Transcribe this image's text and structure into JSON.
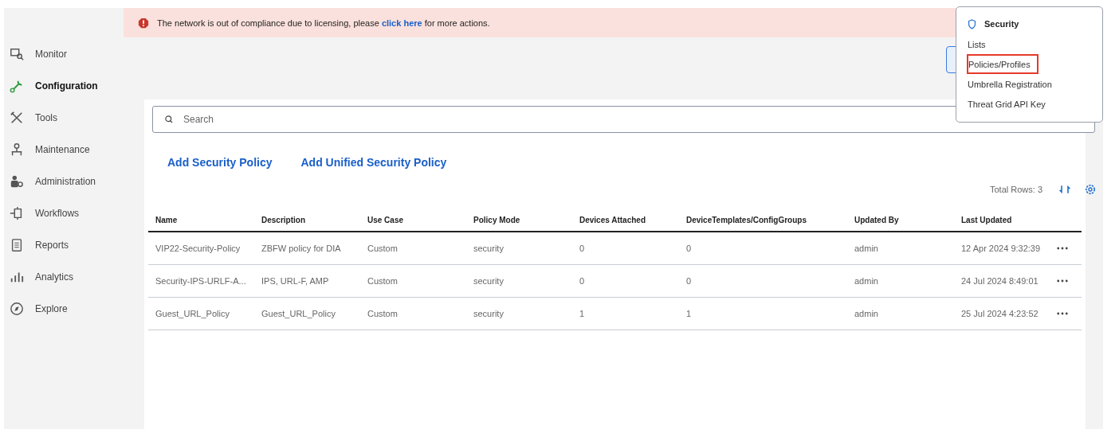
{
  "sidebar": {
    "items": [
      {
        "label": "Monitor",
        "kind": "monitor",
        "selected": false
      },
      {
        "label": "Configuration",
        "kind": "wrench",
        "selected": true
      },
      {
        "label": "Tools",
        "kind": "tools",
        "selected": false
      },
      {
        "label": "Maintenance",
        "kind": "maintenance",
        "selected": false
      },
      {
        "label": "Administration",
        "kind": "admin",
        "selected": false
      },
      {
        "label": "Workflows",
        "kind": "workflow",
        "selected": false
      },
      {
        "label": "Reports",
        "kind": "report",
        "selected": false
      },
      {
        "label": "Analytics",
        "kind": "analytics",
        "selected": false
      },
      {
        "label": "Explore",
        "kind": "explore",
        "selected": false
      }
    ]
  },
  "banner": {
    "before": "The network is out of compliance due to licensing, please ",
    "link": "click here",
    "after": " for more actions."
  },
  "search": {
    "placeholder": "Search"
  },
  "actions": [
    "Add Security Policy",
    "Add Unified Security Policy"
  ],
  "total_rows": "Total Rows: 3",
  "table": {
    "columns": [
      "Name",
      "Description",
      "Use Case",
      "Policy Mode",
      "Devices Attached",
      "DeviceTemplates/ConfigGroups",
      "Updated By",
      "Last Updated"
    ],
    "rows": [
      [
        "VIP22-Security-Policy",
        "ZBFW policy for DIA",
        "Custom",
        "security",
        "0",
        "0",
        "admin",
        "12 Apr 2024 9:32:39"
      ],
      [
        "Security-IPS-URLF-A...",
        "IPS, URL-F, AMP",
        "Custom",
        "security",
        "0",
        "0",
        "admin",
        "24 Jul 2024 8:49:01"
      ],
      [
        "Guest_URL_Policy",
        "Guest_URL_Policy",
        "Custom",
        "security",
        "1",
        "1",
        "admin",
        "25 Jul 2024 4:23:52"
      ]
    ]
  },
  "menu": {
    "title": "Security",
    "items": [
      {
        "label": "Lists",
        "highlighted": false
      },
      {
        "label": "Policies/Profiles",
        "highlighted": true
      },
      {
        "label": "Umbrella Registration",
        "highlighted": false
      },
      {
        "label": "Threat Grid API Key",
        "highlighted": false
      }
    ]
  }
}
